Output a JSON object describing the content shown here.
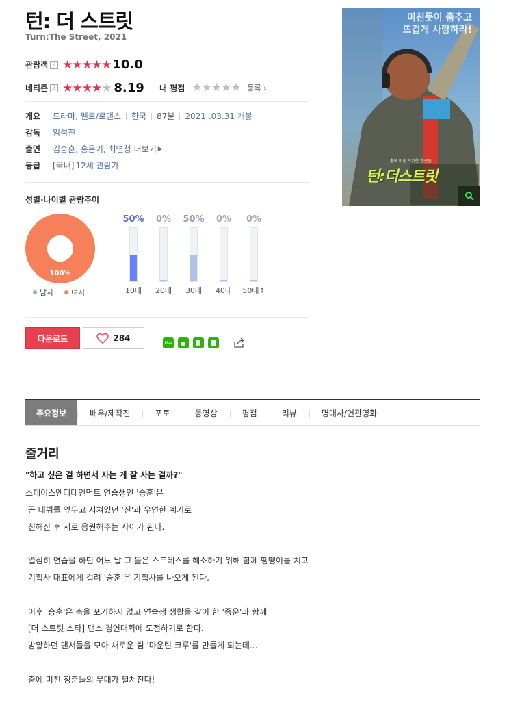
{
  "movie": {
    "title": "턴: 더 스트릿",
    "subtitle": "Turn:The Street, 2021"
  },
  "ratings": {
    "audience_label": "관람객",
    "audience_score": "10.0",
    "audience_stars": 5,
    "netizen_label": "네티즌",
    "netizen_score": "8.19",
    "netizen_stars": 4,
    "my_rating_label": "내 평점",
    "register_label": "등록",
    "help_icon": "?"
  },
  "info": {
    "overview_label": "개요",
    "genre": "드라마, 멜로/로맨스",
    "country": "한국",
    "runtime": "87분",
    "release": "2021 .03.31 개봉",
    "director_label": "감독",
    "director": "임석진",
    "cast_label": "출연",
    "cast": "김승훈, 홍은기, 최연청",
    "cast_more": "더보기",
    "grade_label": "등급",
    "grade_prefix": "[국내]",
    "grade": "12세 관람가"
  },
  "demographics": {
    "title": "성별·나이별 관람추이",
    "pie_label": "100%",
    "female_share": 1.0,
    "legend_male": "남자",
    "legend_female": "여자",
    "male_color": "#7fb2dc",
    "female_color": "#f58059",
    "ages": [
      {
        "label": "10대",
        "pct_text": "50%",
        "value": 0.5,
        "color": "#6682f4",
        "pct_color": "#5a70c8"
      },
      {
        "label": "20대",
        "pct_text": "0%",
        "value": 0.0,
        "color": "#b2c1e6",
        "pct_color": "#a7a7b5"
      },
      {
        "label": "30대",
        "pct_text": "50%",
        "value": 0.5,
        "color": "#b2c1e6",
        "pct_color": "#8e9ab5"
      },
      {
        "label": "40대",
        "pct_text": "0%",
        "value": 0.0,
        "color": "#b2c1e6",
        "pct_color": "#a7a7b5"
      },
      {
        "label": "50대↑",
        "pct_text": "0%",
        "value": 0.0,
        "color": "#b2c1e6",
        "pct_color": "#a7a7b5"
      }
    ]
  },
  "actions": {
    "download": "다운로드",
    "like_count": "284",
    "share_blog_text": "blog"
  },
  "tabs": [
    "주요정보",
    "배우/제작진",
    "포토",
    "동영상",
    "평점",
    "리뷰",
    "명대사/연관영화"
  ],
  "poster": {
    "tagline_1": "미친듯이 춤추고",
    "tagline_2": "뜨겁게 사랑하라!",
    "logo_text": "턴:더스트릿",
    "small_text": "춤에 미친 뜨거운 청춘들"
  },
  "synopsis": {
    "heading": "줄거리",
    "lead": "\"하고 싶은 걸 하면서 사는 게 잘 사는 걸까?\"",
    "body": "스페이스엔터테인먼트 연습생인 '승훈'은\n 곧 데뷔를 앞두고 지쳐있던 '진'과 우연한 계기로\n 친해진 후 서로 응원해주는 사이가 된다.\n\n 열심히 연습을 하던 어느 날 그 둘은 스트레스를 해소하기 위해 함께 땡땡이를 치고\n 기획사 대표에게 걸려 '승훈'은 기획사를 나오게 된다.\n\n 이후 '승훈'은 춤을 포기하지 않고 연습생 생활을 같이 한 '종운'과 함께\n [더 스트릿 스타] 댄스 경연대회에 도전하기로 한다.\n 방황하던 댄서들을 모아 새로운 팀 '마운틴 크루'를 만들게 되는데...\n\n 춤에 미친 청춘들의 무대가 펼쳐진다!"
  }
}
